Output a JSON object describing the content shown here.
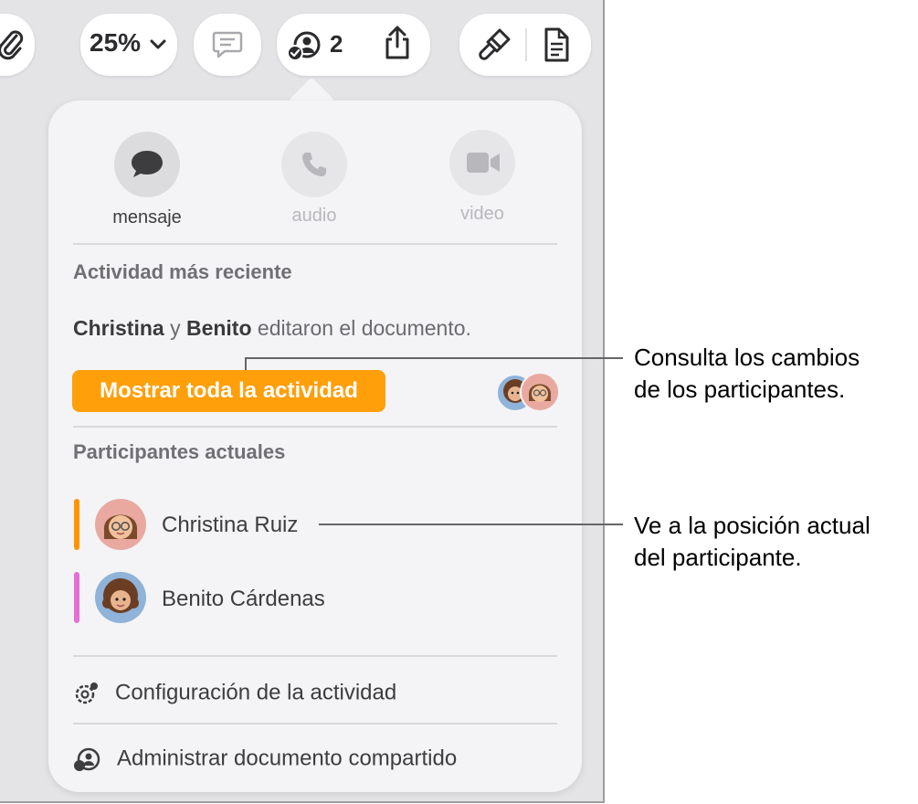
{
  "toolbar": {
    "zoom_value": "25%",
    "collaborator_count": "2"
  },
  "panel": {
    "contact_buttons": [
      {
        "label": "mensaje",
        "icon": "message-icon",
        "enabled": true
      },
      {
        "label": "audio",
        "icon": "phone-icon",
        "enabled": false
      },
      {
        "label": "video",
        "icon": "video-camera-icon",
        "enabled": false
      }
    ],
    "recent_activity": {
      "title": "Actividad más reciente",
      "user1": "Christina",
      "connector": "y",
      "user2": "Benito",
      "action": "editaron el documento.",
      "show_all_label": "Mostrar toda la actividad"
    },
    "participants": {
      "title": "Participantes actuales",
      "list": [
        {
          "name": "Christina Ruiz",
          "color": "#ff9500"
        },
        {
          "name": "Benito Cárdenas",
          "color": "#e56fd8"
        }
      ]
    },
    "menu": {
      "activity_settings": "Configuración de la actividad",
      "manage_shared": "Administrar documento compartido"
    }
  },
  "callouts": {
    "first_line1": "Consulta los cambios",
    "first_line2": "de los participantes.",
    "second_line1": "Ve a la posición actual",
    "second_line2": "del participante."
  },
  "colors": {
    "accent_orange": "#ff9f0a",
    "panel_bg": "#f4f4f6"
  }
}
